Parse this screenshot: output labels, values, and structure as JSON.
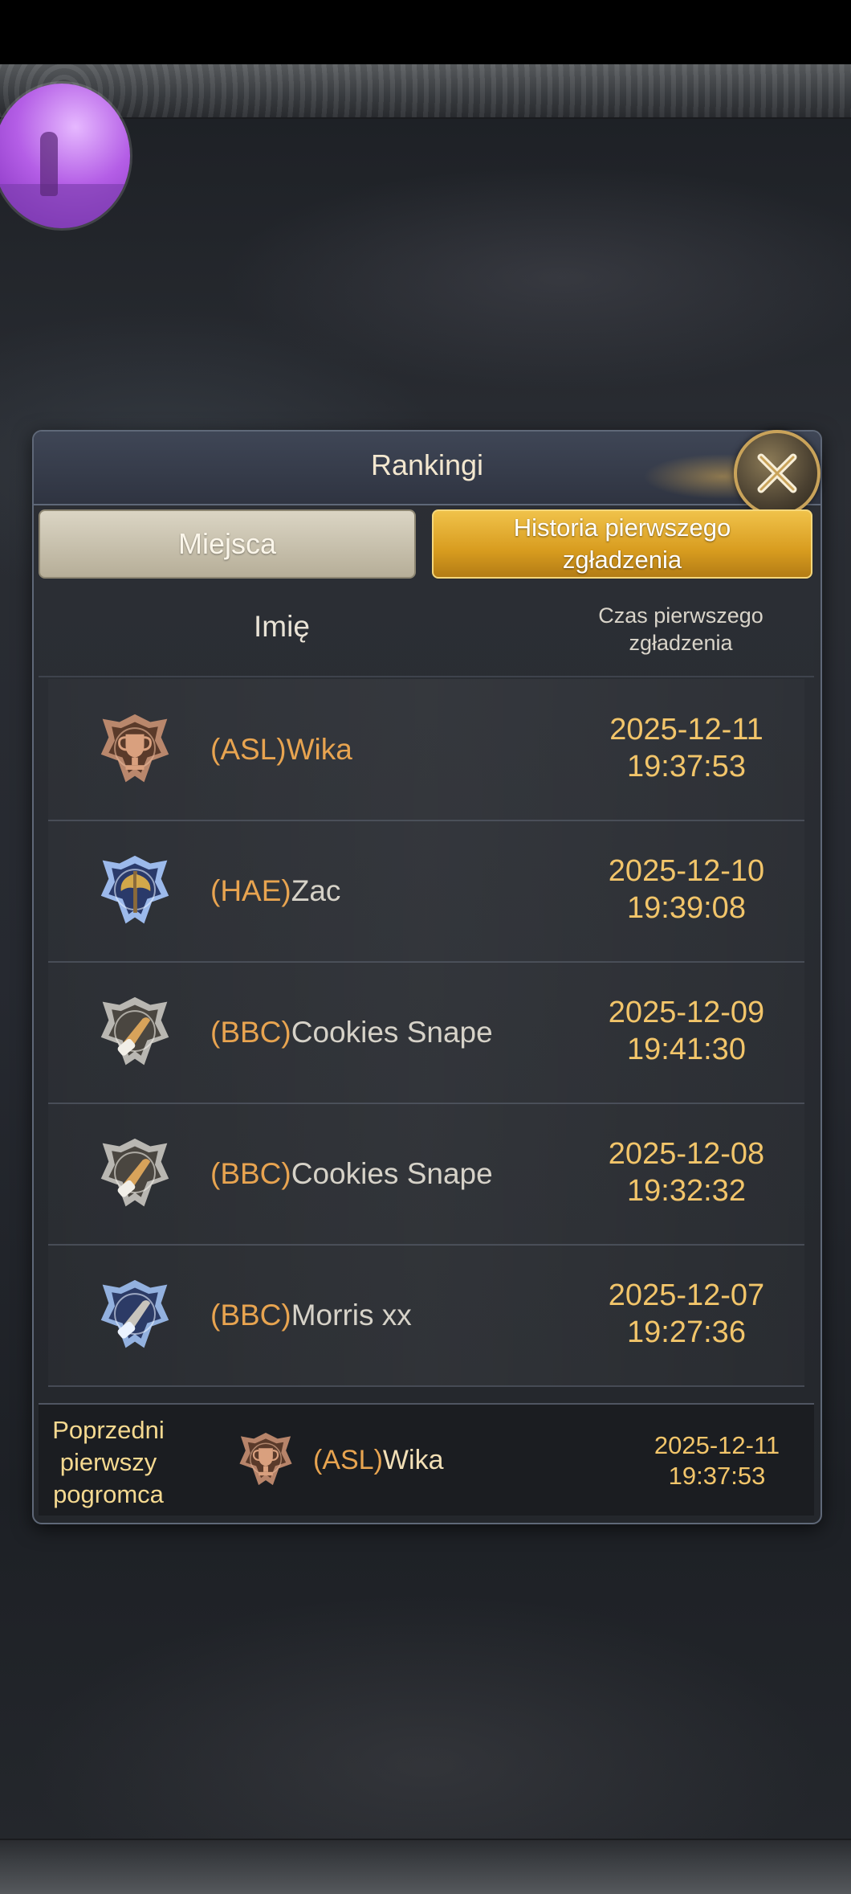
{
  "dialog": {
    "title": "Rankingi",
    "close_icon": "close-x-icon"
  },
  "tabs": [
    {
      "label": "Miejsca",
      "active": false
    },
    {
      "label_lines": [
        "Historia pierwszego",
        "zgładzenia"
      ],
      "active": true
    }
  ],
  "table": {
    "col_name": "Imię",
    "col_time_lines": [
      "Czas pierwszego",
      "zgładzenia"
    ],
    "rows": [
      {
        "tag": "(ASL)",
        "name": "Wika",
        "name_color": "#e8a450",
        "badge": "bronze-trophy-icon",
        "date": "2025-12-11",
        "time": "19:37:53"
      },
      {
        "tag": "(HAE)",
        "name": "Zac",
        "name_color": "#d6d2c8",
        "badge": "blue-axe-icon",
        "date": "2025-12-10",
        "time": "19:39:08"
      },
      {
        "tag": "(BBC)",
        "name": "Cookies Snape",
        "name_color": "#d6d2c8",
        "badge": "silver-gauntlet-icon",
        "date": "2025-12-09",
        "time": "19:41:30"
      },
      {
        "tag": "(BBC)",
        "name": "Cookies Snape",
        "name_color": "#d6d2c8",
        "badge": "silver-gauntlet-icon",
        "date": "2025-12-08",
        "time": "19:32:32"
      },
      {
        "tag": "(BBC)",
        "name": "Morris xx",
        "name_color": "#d6d2c8",
        "badge": "blue-gauntlet-icon",
        "date": "2025-12-07",
        "time": "19:27:36"
      }
    ]
  },
  "footer": {
    "label_lines": [
      "Poprzedni",
      "pierwszy",
      "pogromca"
    ],
    "tag": "(ASL)",
    "name": "Wika",
    "badge": "bronze-trophy-icon",
    "date": "2025-12-11",
    "time": "19:37:53"
  },
  "colors": {
    "gold": "#f2c56a",
    "guild_tag": "#e8a450",
    "active_tab": "#d89c1f"
  }
}
